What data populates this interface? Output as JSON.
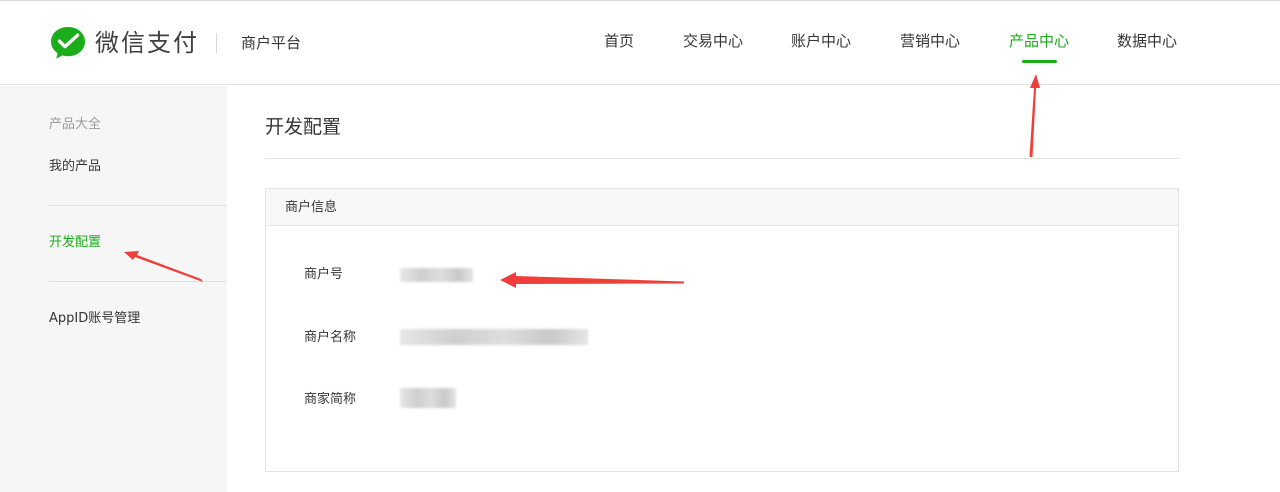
{
  "header": {
    "brand": "微信支付",
    "platform": "商户平台",
    "nav": [
      {
        "label": "首页"
      },
      {
        "label": "交易中心"
      },
      {
        "label": "账户中心"
      },
      {
        "label": "营销中心"
      },
      {
        "label": "产品中心",
        "active": true
      },
      {
        "label": "数据中心"
      }
    ],
    "accent_color": "#1aad19"
  },
  "sidebar": {
    "category": "产品大全",
    "items": [
      {
        "label": "我的产品"
      },
      {
        "label": "开发配置",
        "active": true
      },
      {
        "label": "AppID账号管理"
      }
    ]
  },
  "main": {
    "title": "开发配置",
    "panel": {
      "title": "商户信息",
      "rows": [
        {
          "label": "商户号",
          "value_state": "redacted"
        },
        {
          "label": "商户名称",
          "value_state": "redacted"
        },
        {
          "label": "商家简称",
          "value_state": "redacted"
        }
      ]
    }
  },
  "annotations": {
    "arrow_color": "#ee3f3a"
  }
}
